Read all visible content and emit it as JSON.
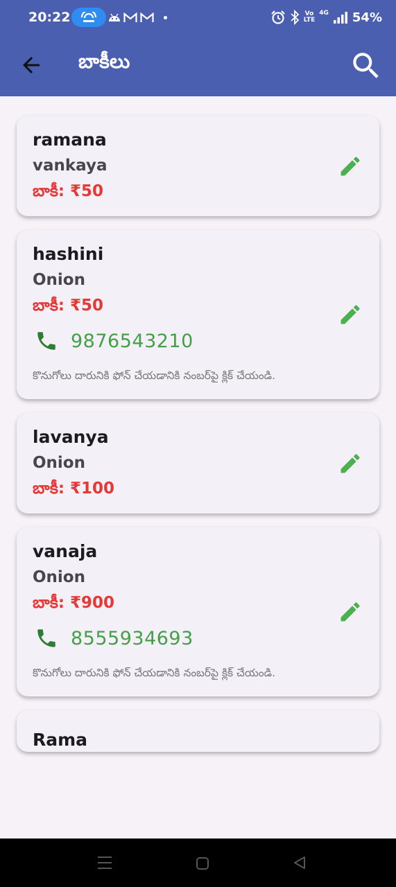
{
  "status_bar": {
    "time": "20:22",
    "network": "4G",
    "volte_top": "Vo",
    "volte_bottom": "LTE",
    "battery": "54%",
    "icons": [
      "hotspot-icon",
      "android-notification-icon",
      "gmail-icon",
      "gmail-icon",
      "alarm-icon",
      "bluetooth-icon",
      "volte-icon",
      "signal-icon"
    ]
  },
  "app_bar": {
    "title": "బాకీలు",
    "back_icon": "arrow-back-icon",
    "search_icon": "search-icon",
    "color": "#4a5fb0"
  },
  "colors": {
    "due": "#e53935",
    "phone": "#43a047",
    "edit": "#4caf50",
    "card_bg": "#f4f0f7"
  },
  "customers": [
    {
      "name": "ramana",
      "item": "vankaya",
      "due": "బాకీ: ₹50"
    },
    {
      "name": "hashini",
      "item": "Onion",
      "due": "బాకీ: ₹50",
      "phone": "9876543210",
      "hint": "కొనుగోలు దారునికి ఫోన్ చేయడానికి నంబర్‌పై క్లిక్ చేయండి."
    },
    {
      "name": "lavanya",
      "item": "Onion",
      "due": "బాకీ: ₹100"
    },
    {
      "name": "vanaja",
      "item": "Onion",
      "due": "బాకీ: ₹900",
      "phone": "8555934693",
      "hint": "కొనుగోలు దారునికి ఫోన్ చేయడానికి నంబర్‌పై క్లిక్ చేయండి."
    },
    {
      "name": "Rama"
    }
  ]
}
